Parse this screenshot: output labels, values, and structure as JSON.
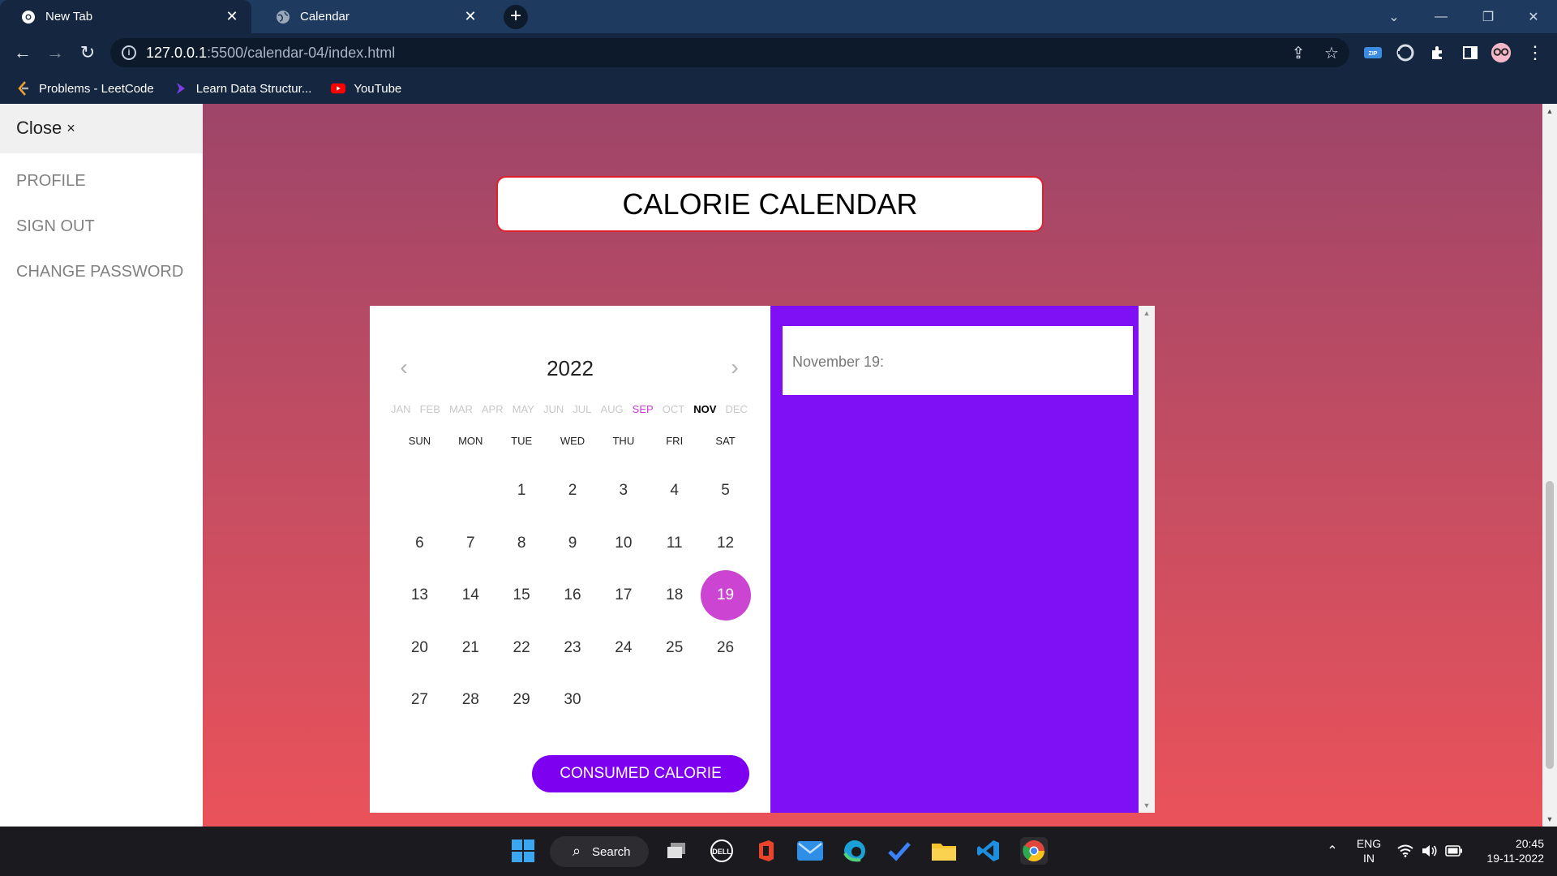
{
  "browser": {
    "tabs": [
      {
        "title": "New Tab",
        "icon": "chrome-icon",
        "active": true
      },
      {
        "title": "Calendar",
        "icon": "globe-icon",
        "active": false
      }
    ],
    "url_host": "127.0.0.1",
    "url_path": ":5500/calendar-04/index.html",
    "bookmarks": [
      {
        "label": "Problems - LeetCode",
        "icon": "leetcode-icon",
        "color": "#f0a030"
      },
      {
        "label": "Learn Data Structur...",
        "icon": "arrow-logo-icon",
        "color": "#7b3fe4"
      },
      {
        "label": "YouTube",
        "icon": "youtube-icon",
        "color": "#ff0000"
      }
    ]
  },
  "sidenav": {
    "close_label": "Close",
    "close_icon": "×",
    "links": [
      "PROFILE",
      "SIGN OUT",
      "CHANGE PASSWORD"
    ]
  },
  "page": {
    "title": "CALORIE CALENDAR",
    "gradient_top": "#9e4569",
    "gradient_bottom": "#ea525a"
  },
  "calendar": {
    "year": "2022",
    "months": [
      "JAN",
      "FEB",
      "MAR",
      "APR",
      "MAY",
      "JUN",
      "JUL",
      "AUG",
      "SEP",
      "OCT",
      "NOV",
      "DEC"
    ],
    "current_month": "NOV",
    "highlight_month": "SEP",
    "weekdays": [
      "SUN",
      "MON",
      "TUE",
      "WED",
      "THU",
      "FRI",
      "SAT"
    ],
    "leading_blanks": 2,
    "days_in_month": 30,
    "selected_day": 19,
    "selected_color": "#cc45d2",
    "button_label": "CONSUMED CALORIE",
    "button_color": "#7e00f0"
  },
  "details": {
    "date_label": "November 19:",
    "panel_color": "#7f0ff5"
  },
  "taskbar": {
    "search_label": "Search",
    "lang_line1": "ENG",
    "lang_line2": "IN",
    "time": "20:45",
    "date": "19-11-2022"
  }
}
